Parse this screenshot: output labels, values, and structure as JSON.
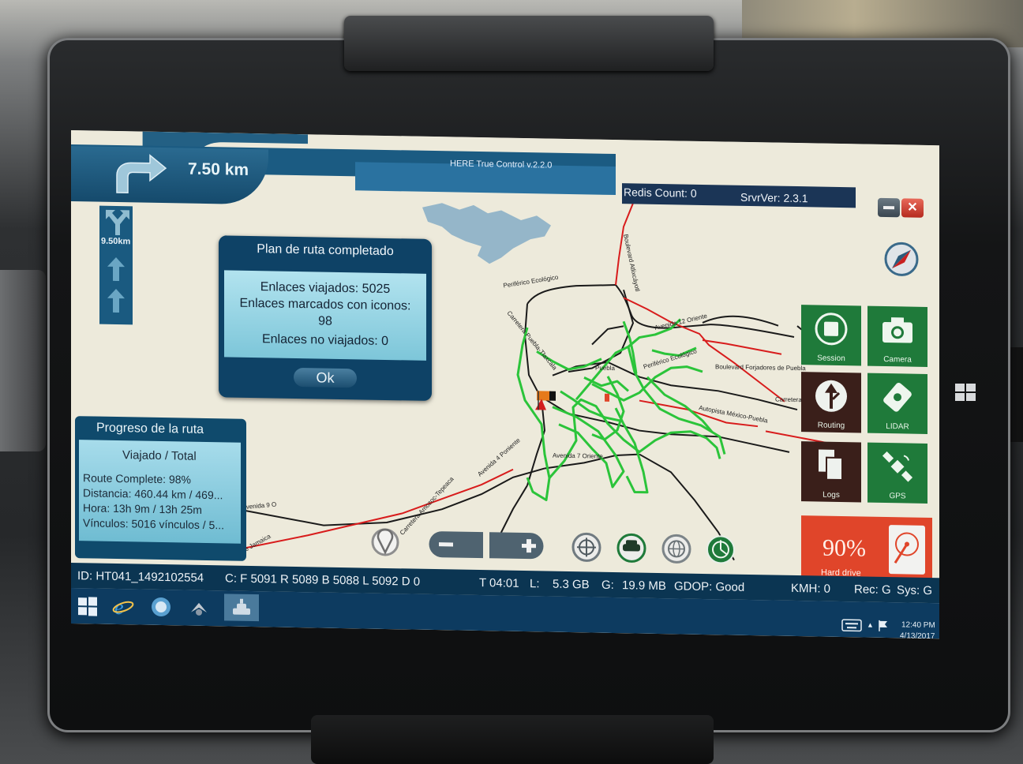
{
  "app": {
    "title": "HERE True Control v.2.2.0"
  },
  "nav": {
    "distance_main": "7.50 km",
    "distance_secondary": "9.50km"
  },
  "server": {
    "redis_count": "Redis Count: 0",
    "srvr_ver": "SrvrVer: 2.3.1"
  },
  "dialog": {
    "title": "Plan de ruta completado",
    "line1": "Enlaces viajados: 5025",
    "line2": "Enlaces marcados con iconos:",
    "line3": "98",
    "line4": "Enlaces no viajados: 0",
    "ok": "Ok"
  },
  "progress": {
    "title": "Progreso de la ruta",
    "subtitle": "Viajado / Total",
    "route_complete": "Route Complete: 98%",
    "distancia": "Distancia: 460.44 km / 469...",
    "hora": "Hora: 13h 9m / 13h 25m",
    "vinculos": "Vínculos: 5016 vínculos / 5..."
  },
  "tiles": {
    "session": "Session",
    "camera": "Camera",
    "routing": "Routing",
    "lidar": "LIDAR",
    "logs": "Logs",
    "gps": "GPS",
    "hard_drive_pct": "90%",
    "hard_drive": "Hard drive"
  },
  "status": {
    "id": "ID: HT041_1492102554",
    "counters": "C: F 5091 R 5089 B 5088 L 5092 D 0",
    "time": "T 04:01",
    "l": "L:",
    "l_val": "5.3 GB",
    "g": "G:",
    "g_val": "19.9 MB",
    "gdop": "GDOP: Good",
    "kmh": "KMH: 0",
    "rec": "Rec: G",
    "sys": "Sys: G"
  },
  "taskbar": {
    "time": "12:40 PM",
    "date": "4/13/2017"
  },
  "map_labels": {
    "l1": "Periférico Ecológico",
    "l2": "Boulevard Atlixcáyotl",
    "l3": "Avenida 12 Oriente",
    "l4": "Carretera Puebla-Tlaxcala",
    "l5": "Puebla",
    "l6": "Periférico Ecológico",
    "l7": "Boulevard Forjadores de Puebla",
    "l8": "Carretera",
    "l9": "Autopista México-Puebla",
    "l10": "Avenida 7 Oriente",
    "l11": "Avenida 4 Poniente",
    "l12": "Carretera Amozoc-Tepeaca",
    "l13": "venida 9 O",
    "l14": "de Jamaica"
  },
  "colors": {
    "accent": "#0e4266",
    "track": "#2bc43a",
    "road_major": "#d81c1c",
    "road": "#1a1a1a",
    "water": "#7ea9c4",
    "tile_green": "#1f7a3a",
    "tile_dark": "#3a1f1a",
    "tile_red": "#e0452a"
  },
  "storage": {
    "hard_drive_fill": 0.9
  }
}
